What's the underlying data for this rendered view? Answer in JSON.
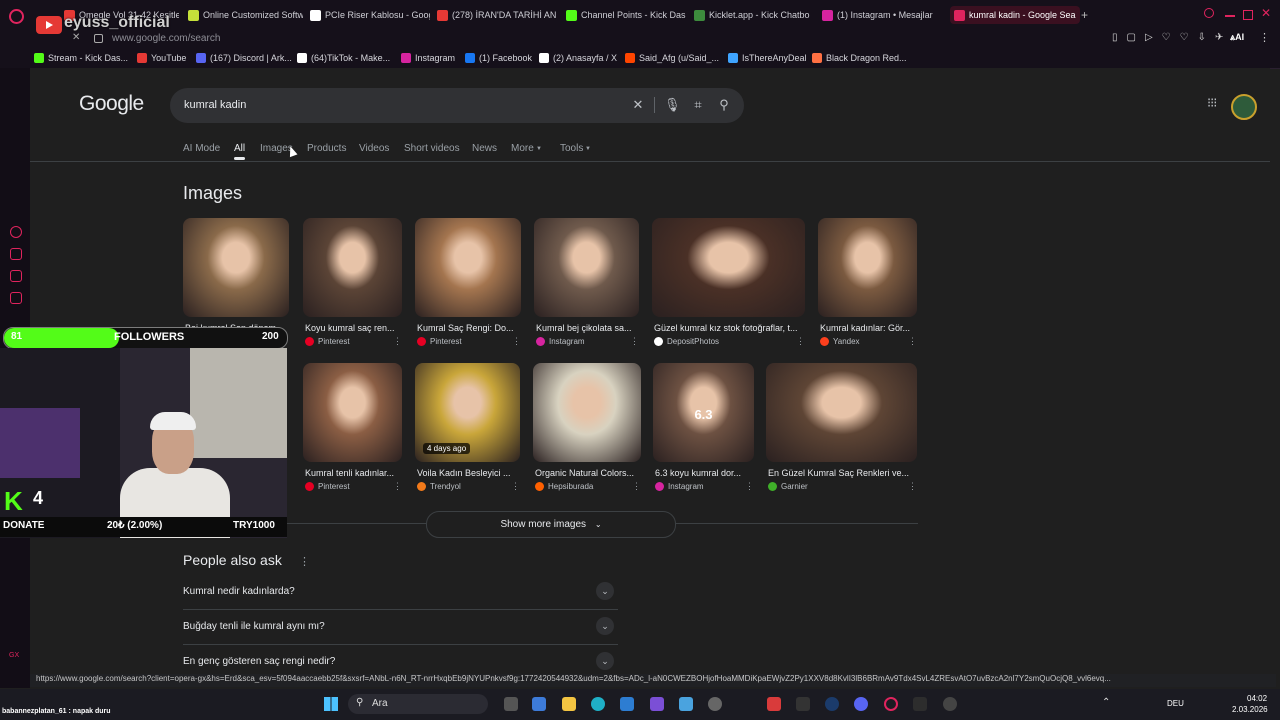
{
  "tabs": [
    {
      "label": "Omegle Vol 31-42 Kesitler",
      "color": "#e53935"
    },
    {
      "label": "Online Customized Softw",
      "color": "#c6e03a"
    },
    {
      "label": "PCIe Riser Kablosu - Goog",
      "color": "#ffffff"
    },
    {
      "label": "(278) İRAN'DA TARİHİ AN",
      "color": "#e53935"
    },
    {
      "label": "Channel Points - Kick Das",
      "color": "#53fc18"
    },
    {
      "label": "Kicklet.app - Kick Chatbo",
      "color": "#3d8b3d"
    },
    {
      "label": "(1) Instagram • Mesajlar",
      "color": "#d6249f"
    },
    {
      "label": "kumral kadin - Google Sea",
      "color": "#e0245e"
    }
  ],
  "address": "www.google.com/search",
  "overlay_channel": "eyuss_official",
  "bookmarks": [
    {
      "label": "Stream - Kick Das...",
      "color": "#53fc18"
    },
    {
      "label": "YouTube",
      "color": "#e53935"
    },
    {
      "label": "(167) Discord | Ark...",
      "color": "#5865f2"
    },
    {
      "label": "(64)TikTok - Make...",
      "color": "#ffffff"
    },
    {
      "label": "Instagram",
      "color": "#d6249f"
    },
    {
      "label": "(1) Facebook",
      "color": "#1877f2"
    },
    {
      "label": "(2) Anasayfa / X",
      "color": "#ffffff"
    },
    {
      "label": "Said_Afg (u/Said_...",
      "color": "#ff4500"
    },
    {
      "label": "IsThereAnyDeal",
      "color": "#3fa4ff"
    },
    {
      "label": "Black Dragon Red...",
      "color": "#ff7043"
    }
  ],
  "google": {
    "logo": "Google",
    "query": "kumral kadin",
    "nav": [
      "AI Mode",
      "All",
      "Images",
      "Products",
      "Videos",
      "Short videos",
      "News",
      "More",
      "Tools"
    ],
    "images_heading": "Images",
    "images": [
      {
        "caption": "Bej kumral Son dönem...",
        "source": "Instagram",
        "src_color": "#d6249f",
        "img": "#8a6a4a"
      },
      {
        "caption": "Koyu kumral saç ren...",
        "source": "Pinterest",
        "src_color": "#e60023",
        "img": "#5b4436"
      },
      {
        "caption": "Kumral Saç Rengi: Do...",
        "source": "Pinterest",
        "src_color": "#e60023",
        "img": "#a4754f"
      },
      {
        "caption": "Kumral bej çikolata sa...",
        "source": "Instagram",
        "src_color": "#d6249f",
        "img": "#6f5a4c"
      },
      {
        "caption": "Güzel kumral kız stok fotoğraflar, t...",
        "source": "DepositPhotos",
        "src_color": "#ffffff",
        "img": "#4a3026"
      },
      {
        "caption": "Kumral kadınlar: Gör...",
        "source": "Yandex",
        "src_color": "#fc3f1d",
        "img": "#7b5a40"
      },
      {
        "caption": "Kumral tenli kadınlar...",
        "source": "Pinterest",
        "src_color": "#e60023",
        "img": "#8b5e44"
      },
      {
        "caption": "Voila Kadın Besleyici ...",
        "source": "Trendyol",
        "src_color": "#f27a1a",
        "img": "#c9a63a",
        "badge": "4 days ago"
      },
      {
        "caption": "Organic Natural Colors...",
        "source": "Hepsiburada",
        "src_color": "#ff6000",
        "img": "#d8d2c0"
      },
      {
        "caption": "6.3 koyu kumral dor...",
        "source": "Instagram",
        "src_color": "#d6249f",
        "img": "#6d5142",
        "label": "6.3"
      },
      {
        "caption": "En Güzel Kumral Saç Renkleri ve...",
        "source": "Garnier",
        "src_color": "#3fae29",
        "img": "#5e4535"
      }
    ],
    "show_more": "Show more images",
    "paa_title": "People also ask",
    "questions": [
      "Kumral nedir kadınlarda?",
      "Buğday tenli ile kumral aynı mı?",
      "En genç gösteren saç rengi nedir?"
    ]
  },
  "overlay": {
    "followers_count": "81",
    "followers_label": "FOLLOWERS",
    "followers_goal": "200",
    "followers_progress": 0.405,
    "kick_count": "4",
    "donate_label": "DONATE",
    "donate_amount": "20₺ (2.00%)",
    "donate_goal": "TRY1000"
  },
  "status_url": "https://www.google.com/search?client=opera-gx&hs=Erd&sca_esv=5f094aaccaebb25f&sxsrf=ANbL-n6N_RT-nrrHxqbEb9jNYUPnkvsf9g:1772420544932&udm=2&fbs=ADc_l-aN0CWEZBOHjofHoaMMDiKpaEWjvZ2Py1XXV8d8KvlI3lB6BRmAv9Tdx4SvL4ZREsvAtO7uvBzcA2nl7Y2smQuOcjQ8_vvl6evq...",
  "chat_line": "babannezplatan_61 : napak duru",
  "taskbar": {
    "search": "Ara",
    "lang": "DEU",
    "time": "04:02",
    "date": "2.03.2026"
  }
}
